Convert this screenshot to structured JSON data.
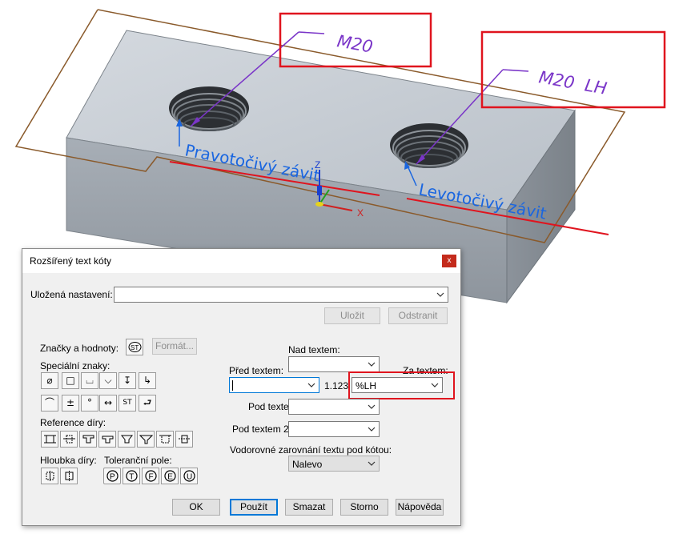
{
  "scene": {
    "label_right_hand_thread": "M20",
    "label_left_hand_thread": "M20  LH",
    "note_right_hand": "Pravotočivý závit",
    "note_left_hand": "Levotočivý závit",
    "axis_z": "Z",
    "axis_x": "X"
  },
  "dialog": {
    "title": "Rozšířený text kóty",
    "close_glyph": "x",
    "saved_settings_label": "Uložená nastavení:",
    "saved_settings_value": "",
    "save_button": "Uložit",
    "delete_button": "Odstranit",
    "symbols_values_label": "Značky a hodnoty:",
    "format_button": "Formát...",
    "special_chars_label": "Speciální znaky:",
    "special_chars_row1": [
      "⌀",
      "□",
      "⌴",
      "⌵",
      "↧",
      "↳"
    ],
    "special_chars_row2": [
      "⌒",
      "±",
      "°",
      "↔",
      "ST",
      "⮐"
    ],
    "hole_reference_label": "Reference díry:",
    "hole_depth_label": "Hloubka díry:",
    "tolerance_field_label": "Toleranční pole:",
    "tolerance_symbols": [
      "P",
      "T",
      "F",
      "E",
      "U"
    ],
    "above_text_label": "Nad textem:",
    "above_text_value": "",
    "before_text_label": "Před textem:",
    "before_text_value": "",
    "dimension_value": "1.123",
    "after_text_label": "Za textem:",
    "after_text_value": "%LH",
    "below_text_label": "Pod textem:",
    "below_text_value": "",
    "below_text2_label": "Pod textem 2:",
    "below_text2_value": "",
    "horizontal_align_label": "Vodorovné zarovnání textu pod kótou:",
    "horizontal_align_value": "Nalevo",
    "ok_button": "OK",
    "apply_button": "Použít",
    "clear_button": "Smazat",
    "cancel_button": "Storno",
    "help_button": "Nápověda"
  },
  "colors": {
    "highlight_box": "#e0141e",
    "annotation_text": "#1a66e0",
    "thread_label": "#7a35c8",
    "underline": "#e0141e",
    "plane_outline": "#8a5a2b",
    "part_face_top": "#c9cfd6",
    "part_face_front": "#9aa1a9",
    "part_face_side": "#868d95"
  }
}
